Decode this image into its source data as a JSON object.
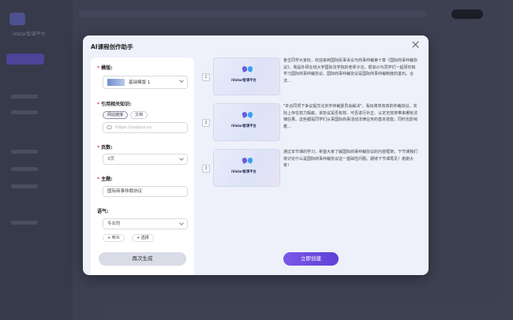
{
  "modal": {
    "title": "AI课程创作助手"
  },
  "form": {
    "style_label": "模版:",
    "style_value": "基础模版 1",
    "knowledge_label": "引用相关知识:",
    "knowledge_tabs": [
      "网站链接",
      "文档"
    ],
    "url_placeholder": "https://unipus.cn",
    "pages_label": "页数:",
    "pages_value": "3页",
    "topic_label": "主题:",
    "topic_value": "国际商事仲裁协议",
    "tone_label": "语气:",
    "tone_value": "专业的",
    "add_buttons": [
      "+ 听众",
      "+ 选择"
    ],
    "regenerate_label": "再次生成"
  },
  "slides": [
    {
      "number": "1",
      "card_text": "iVatar智课平台",
      "text": "各位同学大家好，欢迎来到国际民事诉讼与商事仲裁第十章《国际商事仲裁协议》。我是外研在线大学国际法学院的老师子言，很高兴与同学们一起研究和学习国际商事仲裁协议。国际商事仲裁协议是国际商事仲裁制度的基石。合法..."
    },
    {
      "number": "2",
      "card_text": "iVatar智课平台",
      "text": "\"本合同项下争议提交北京市仲裁委员会解决\"，看似简单有效的仲裁协议，实际上存在效力瑕疵。该协议是否有效、可否进行补正、认定无效将带来哪些法律后果。这些都是同学们从事国际商事活动法律业务的基本技能，同时也影响着..."
    },
    {
      "number": "3",
      "card_text": "iVatar智课平台",
      "text": "通过本节课的学习，希望大家了解国际商事仲裁协议的内容框架。下节课我们将讨论什么是国际商事仲裁协议这一基础性问题。期待下节课再见！谢谢大家！"
    }
  ],
  "create_label": "立即创建",
  "background": {
    "app_name": "iVatar智课平台"
  },
  "colors": {
    "accent": "#6a4be0",
    "required": "#e04848",
    "modal_bg": "#eef0fa"
  }
}
